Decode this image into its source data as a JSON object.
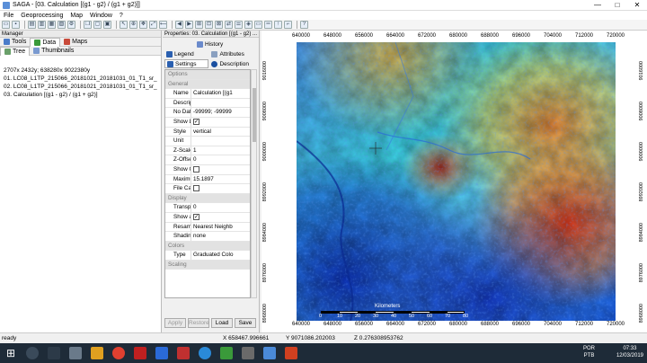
{
  "window": {
    "title": "SAGA - [03. Calculation [(g1 - g2) / (g1 + g2)]]",
    "controls": [
      "—",
      "□",
      "✕"
    ]
  },
  "menu": [
    "File",
    "Geoprocessing",
    "Map",
    "Window",
    "?"
  ],
  "manager": {
    "header": "Manager",
    "tabs": [
      {
        "label": "Tools",
        "color": "#4a7cc9"
      },
      {
        "label": "Data",
        "color": "#3a9a3a"
      },
      {
        "label": "Maps",
        "color": "#c84a3a"
      }
    ],
    "subtabs": [
      {
        "label": "Tree"
      },
      {
        "label": "Thumbnails"
      }
    ],
    "items": [
      "2707x 2432y; 638280x 9022380y",
      "01. LC08_L1TP_215066_20181021_20181031_01_T1_sr_band4",
      "02. LC08_L1TP_215066_20181021_20181031_01_T1_sr_band5",
      "03. Calculation [(g1 - g2) / (g1 + g2)]"
    ]
  },
  "properties": {
    "header": "Properties: 03. Calculation [(g1 - g2) ...",
    "buttons": [
      "History",
      "Legend",
      "Attributes",
      "Settings",
      "Description"
    ],
    "options_label": "Options",
    "rows": [
      {
        "cat": true,
        "k": "General"
      },
      {
        "k": "Name",
        "v": "Calculation [(g1"
      },
      {
        "k": "Descripti",
        "v": ""
      },
      {
        "k": "No Data",
        "v": "-99999; -99999"
      },
      {
        "k": "Show Leg",
        "v": "",
        "cb": true
      },
      {
        "k": "Style",
        "v": "vertical"
      },
      {
        "k": "Unit",
        "v": ""
      },
      {
        "k": "Z-Scale",
        "v": "1"
      },
      {
        "k": "Z-Offset",
        "v": "0"
      },
      {
        "k": "Show Cel",
        "v": "",
        "cb": false
      },
      {
        "k": "Maximun",
        "v": "15.1897"
      },
      {
        "k": "File Cach",
        "v": "",
        "cb": false
      },
      {
        "cat": true,
        "k": "Display"
      },
      {
        "k": "Transpar",
        "v": "0"
      },
      {
        "k": "Show at a",
        "v": "",
        "cb": true
      },
      {
        "k": "Resampli",
        "v": "Nearest Neighb"
      },
      {
        "k": "Shading",
        "v": "none"
      },
      {
        "cat": true,
        "k": "Colors"
      },
      {
        "k": "Type",
        "v": "Graduated Colo"
      },
      {
        "cat": true,
        "k": "Scaling"
      }
    ],
    "apply": "Apply",
    "restore": "Restore",
    "load": "Load",
    "save": "Save"
  },
  "map": {
    "x_ticks": [
      "640000",
      "648000",
      "656000",
      "664000",
      "672000",
      "680000",
      "688000",
      "696000",
      "704000",
      "712000",
      "720000"
    ],
    "y_ticks": [
      "9016000",
      "9008000",
      "9000000",
      "8992000",
      "8984000",
      "8976000",
      "8968000"
    ],
    "scale_label": "Kilometers",
    "scale_ticks": [
      "0",
      "10",
      "20",
      "30",
      "40",
      "50",
      "60",
      "70",
      "80"
    ]
  },
  "status": {
    "ready": "ready",
    "x": "X 658467.996661",
    "y": "Y 9071086.202003",
    "z": "Z 0.276308953762"
  },
  "taskbar": {
    "lang1": "POR",
    "lang2": "PTB",
    "time": "07:33",
    "date": "12/03/2019"
  }
}
